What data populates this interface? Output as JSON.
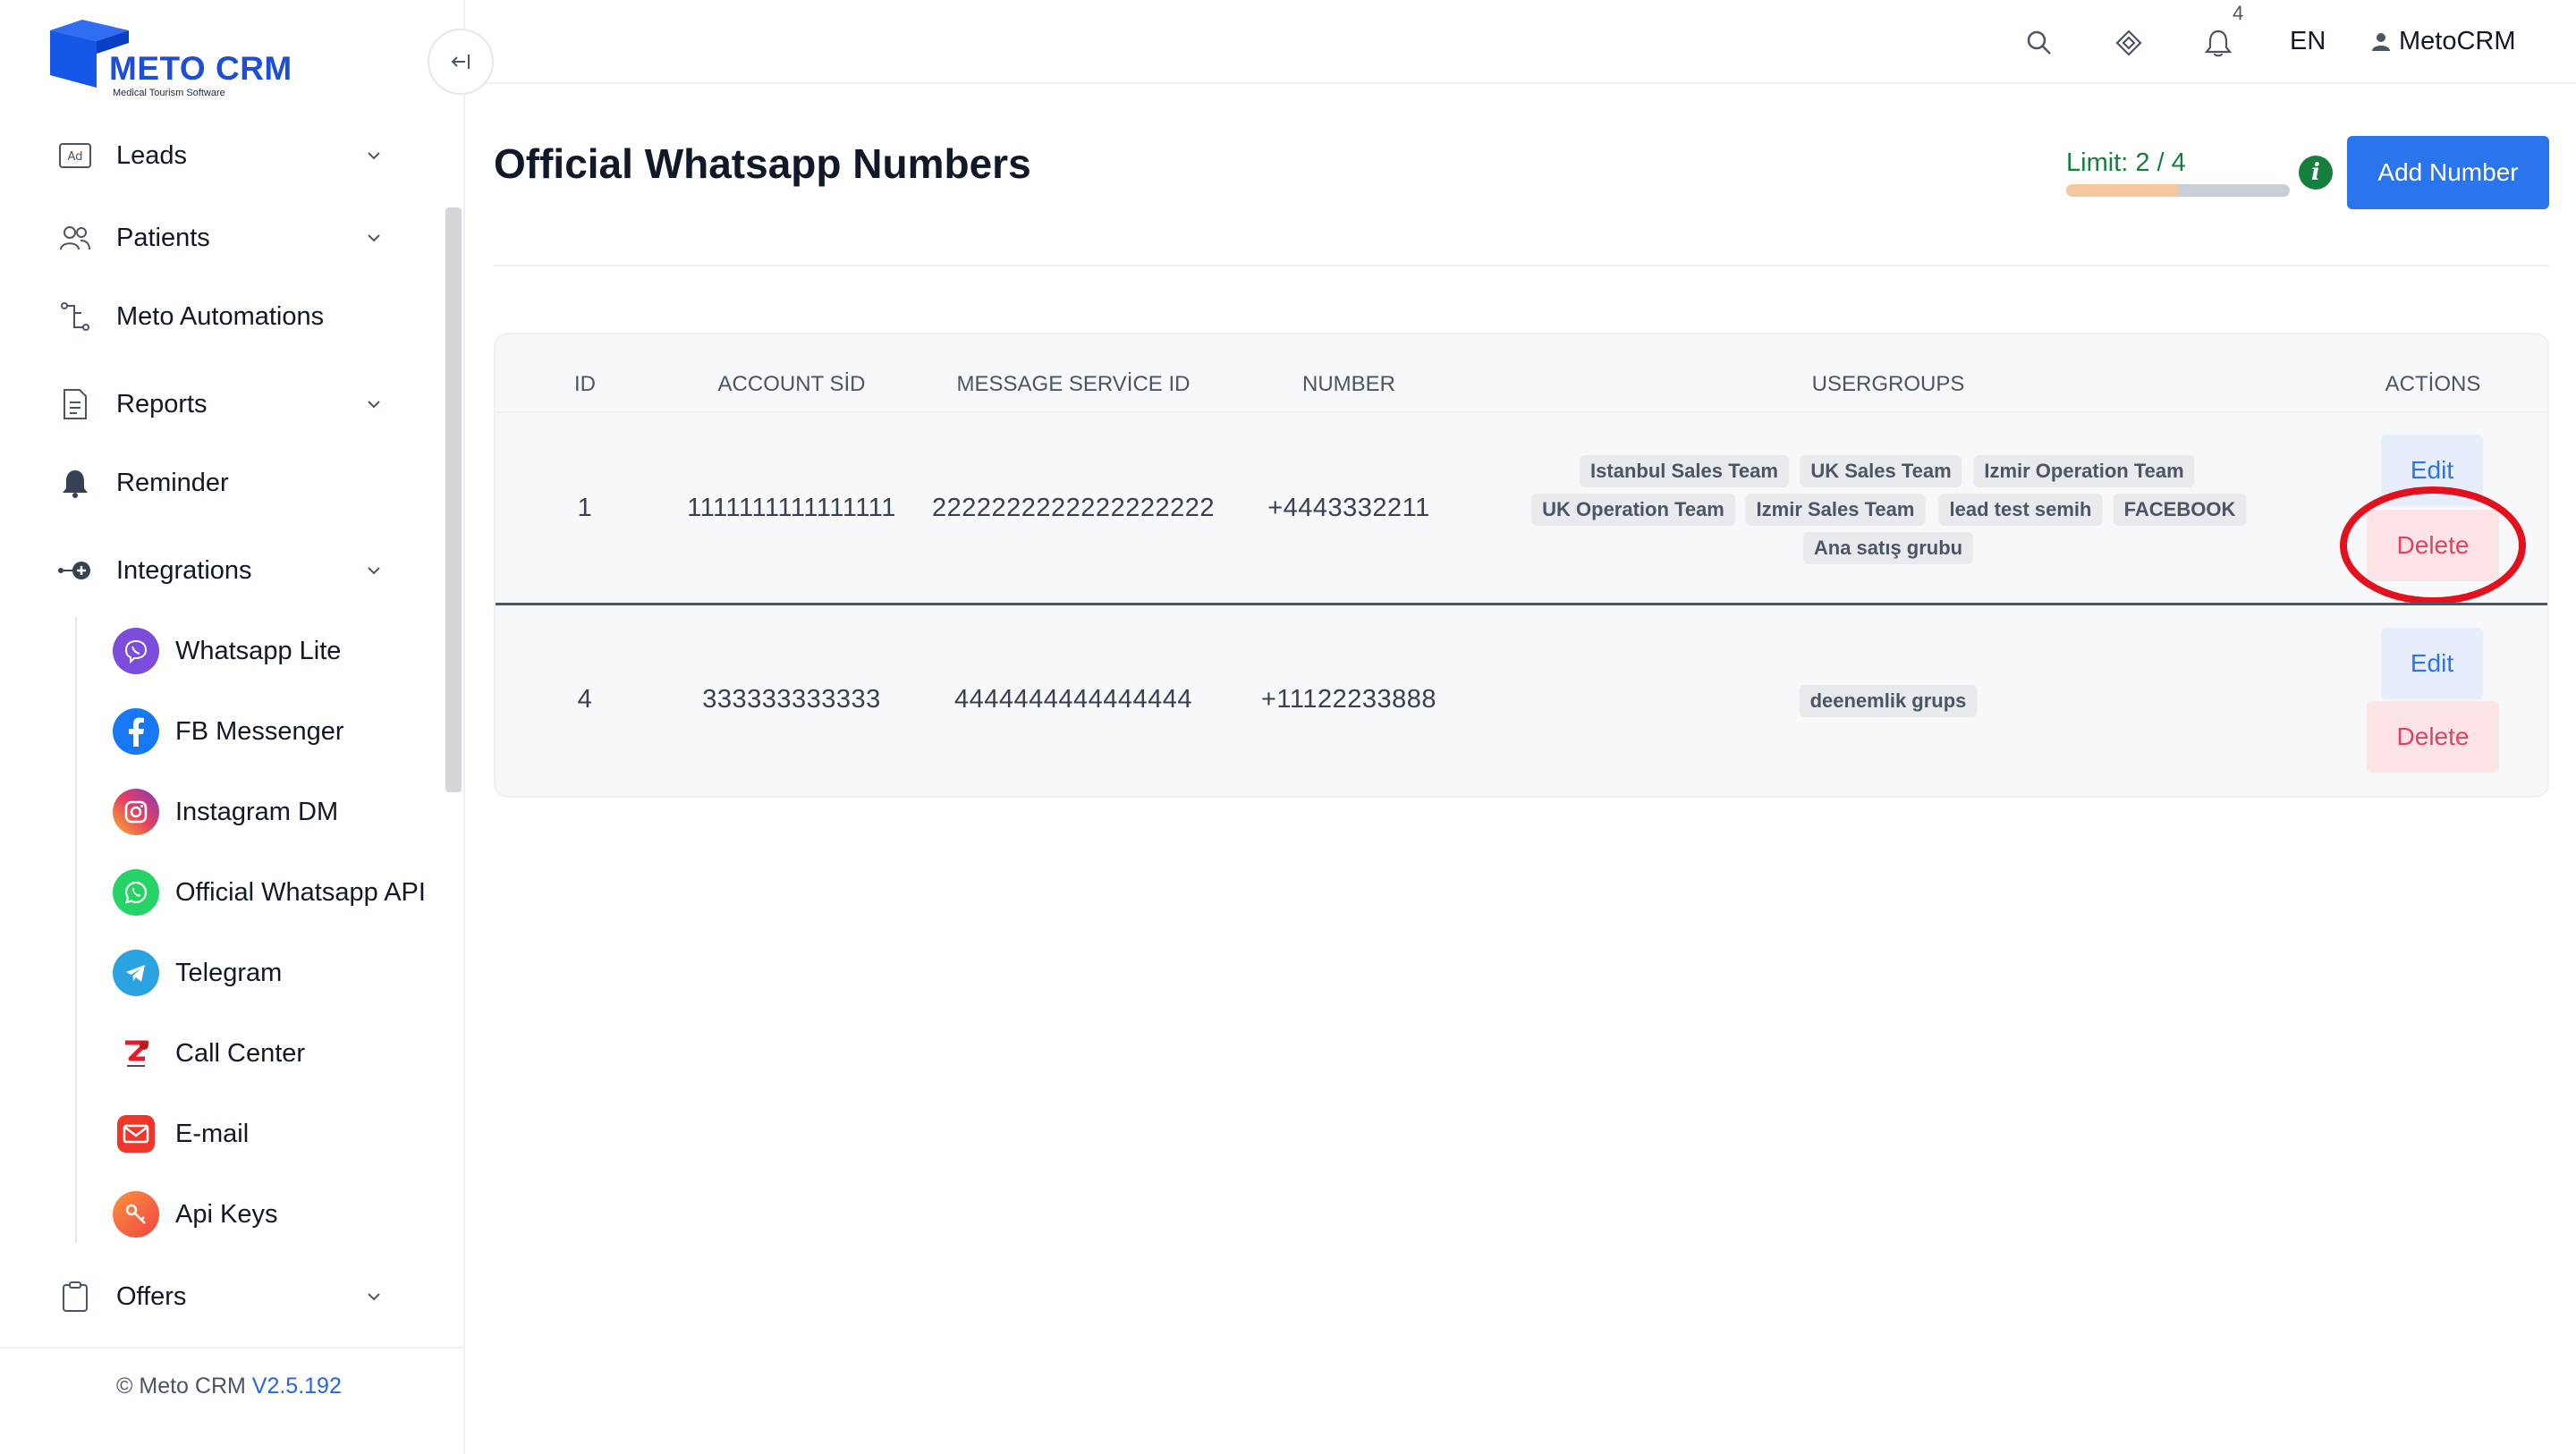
{
  "brand": {
    "name": "METO CRM",
    "tagline": "Medical Tourism Software"
  },
  "sidebar": {
    "items": [
      {
        "label": "Leads",
        "icon": "ad-icon",
        "has_chevron": true
      },
      {
        "label": "Patients",
        "icon": "users-icon",
        "has_chevron": true
      },
      {
        "label": "Meto Automations",
        "icon": "automation-icon",
        "has_chevron": false
      },
      {
        "label": "Reports",
        "icon": "document-icon",
        "has_chevron": true
      },
      {
        "label": "Reminder",
        "icon": "bell-icon",
        "has_chevron": false
      },
      {
        "label": "Integrations",
        "icon": "integrations-icon",
        "has_chevron": true
      },
      {
        "label": "Offers",
        "icon": "clipboard-icon",
        "has_chevron": true
      }
    ],
    "integrations": [
      {
        "label": "Whatsapp Lite",
        "icon": "viber-icon"
      },
      {
        "label": "FB Messenger",
        "icon": "facebook-icon"
      },
      {
        "label": "Instagram DM",
        "icon": "instagram-icon"
      },
      {
        "label": "Official Whatsapp API",
        "icon": "whatsapp-icon"
      },
      {
        "label": "Telegram",
        "icon": "telegram-icon"
      },
      {
        "label": "Call Center",
        "icon": "zadarma-icon"
      },
      {
        "label": "E-mail",
        "icon": "mail-icon"
      },
      {
        "label": "Api Keys",
        "icon": "key-icon"
      }
    ],
    "footer": {
      "copyright": "© Meto CRM",
      "version": "V2.5.192"
    }
  },
  "topbar": {
    "notification_count": "4",
    "language": "EN",
    "user_name": "MetoCRM"
  },
  "page": {
    "title": "Official Whatsapp Numbers",
    "limit_label": "Limit: 2 / 4",
    "limit_used": 2,
    "limit_total": 4,
    "info_glyph": "i",
    "add_button": "Add Number"
  },
  "table": {
    "headers": [
      "ID",
      "ACCOUNT SİD",
      "MESSAGE SERVİCE ID",
      "NUMBER",
      "USERGROUPS",
      "ACTİONS"
    ],
    "rows": [
      {
        "id": "1",
        "account_sid": "1111111111111111",
        "message_service_id": "2222222222222222222",
        "number": "+4443332211",
        "usergroups": [
          "Istanbul Sales Team",
          "UK Sales Team",
          "Izmir Operation Team",
          "UK Operation Team",
          "Izmir Sales Team",
          "lead test semih",
          "FACEBOOK",
          "Ana satış grubu"
        ],
        "edit_label": "Edit",
        "delete_label": "Delete"
      },
      {
        "id": "4",
        "account_sid": "333333333333",
        "message_service_id": "4444444444444444",
        "number": "+11122233888",
        "usergroups": [
          "deenemlik grups"
        ],
        "edit_label": "Edit",
        "delete_label": "Delete"
      }
    ]
  },
  "colors": {
    "primary": "#2a74ec",
    "brand": "#1d4ed8",
    "success": "#15803d",
    "danger": "#e0445e",
    "highlight": "#e3111d"
  }
}
